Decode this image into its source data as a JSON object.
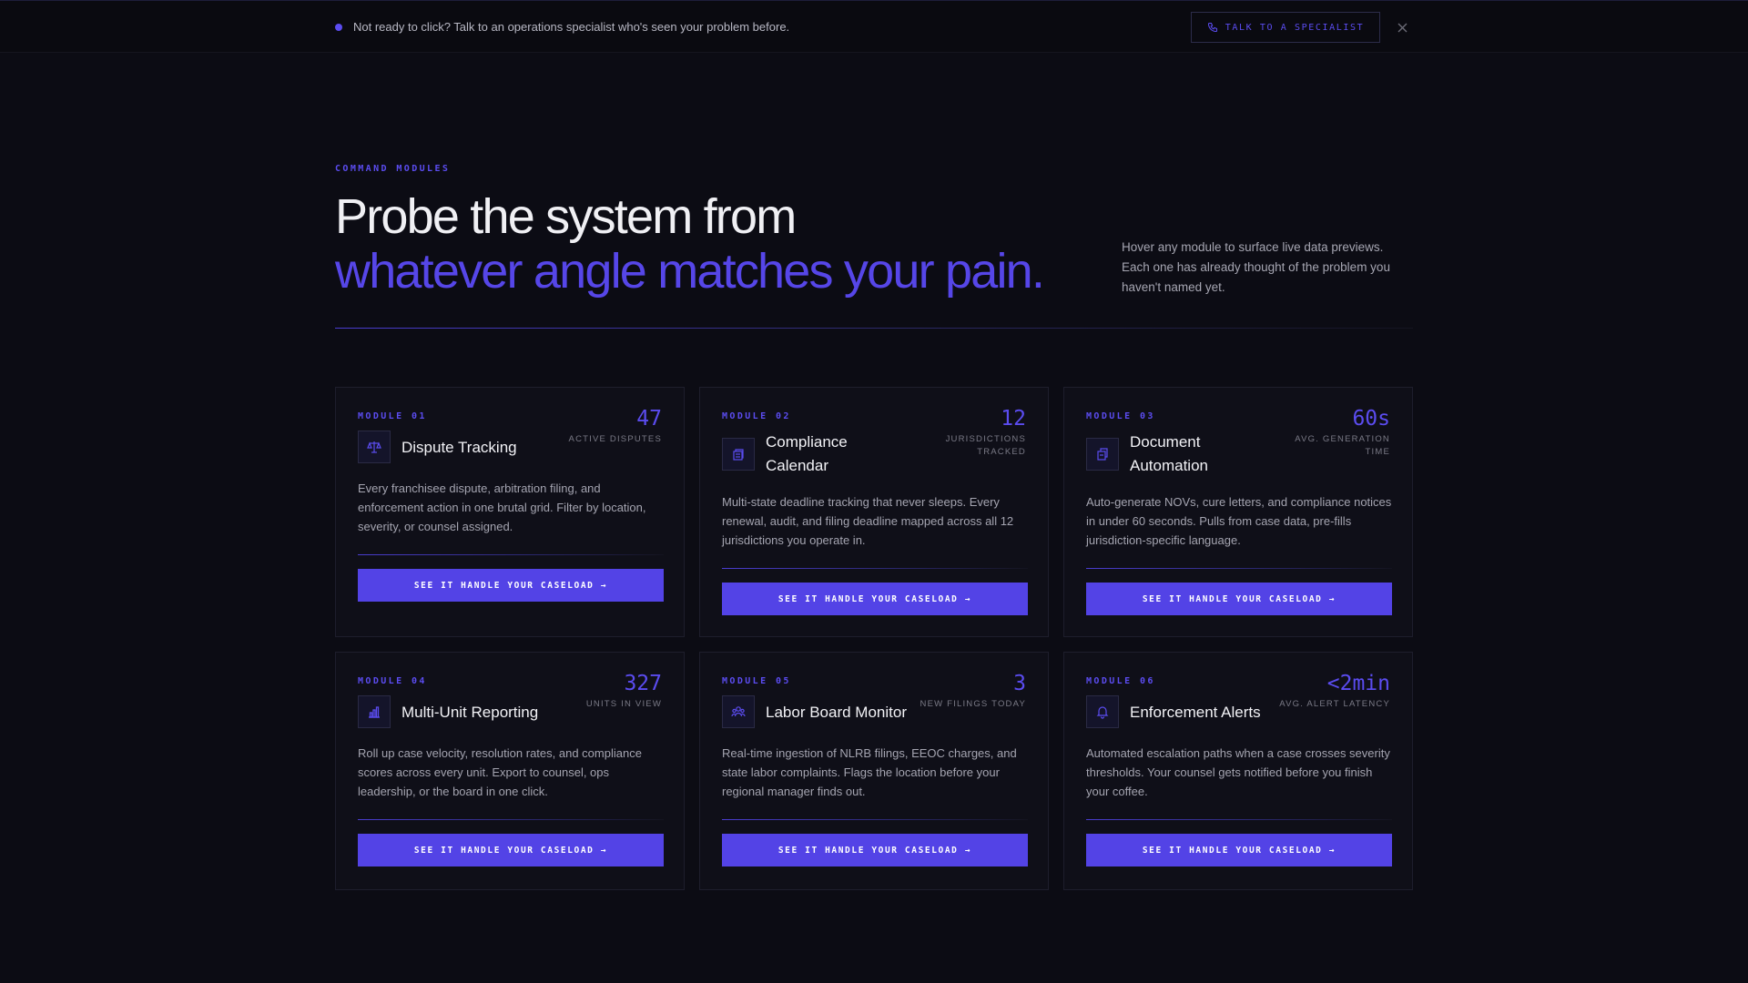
{
  "banner": {
    "text": "Not ready to click? Talk to an operations specialist who's seen your problem before.",
    "cta_label": "TALK TO A SPECIALIST",
    "close_glyph": "×"
  },
  "hero": {
    "eyebrow": "COMMAND MODULES",
    "title_line1": "Probe the system from",
    "title_line2": "whatever angle matches your pain.",
    "description": "Hover any module to surface live data previews. Each one has already thought of the problem you haven't named yet."
  },
  "colors": {
    "background": "#0c0c14",
    "accent": "#5b4cf0",
    "button": "#5343e6"
  },
  "modules": [
    {
      "label": "MODULE 01",
      "title": "Dispute Tracking",
      "stat_value": "47",
      "stat_label": "ACTIVE DISPUTES",
      "icon": "scale-icon",
      "description": "Every franchisee dispute, arbitration filing, and enforcement action in one brutal grid. Filter by location, severity, or counsel assigned.",
      "cta": "SEE IT HANDLE YOUR CASELOAD →"
    },
    {
      "label": "MODULE 02",
      "title": "Compliance Calendar",
      "stat_value": "12",
      "stat_label": "JURISDICTIONS TRACKED",
      "icon": "calendar-icon",
      "description": "Multi-state deadline tracking that never sleeps. Every renewal, audit, and filing deadline mapped across all 12 jurisdictions you operate in.",
      "cta": "SEE IT HANDLE YOUR CASELOAD →"
    },
    {
      "label": "MODULE 03",
      "title": "Document Automation",
      "stat_value": "60s",
      "stat_label": "AVG. GENERATION TIME",
      "icon": "documents-icon",
      "description": "Auto-generate NOVs, cure letters, and compliance notices in under 60 seconds. Pulls from case data, pre-fills jurisdiction-specific language.",
      "cta": "SEE IT HANDLE YOUR CASELOAD →"
    },
    {
      "label": "MODULE 04",
      "title": "Multi-Unit Reporting",
      "stat_value": "327",
      "stat_label": "UNITS IN VIEW",
      "icon": "bar-chart-icon",
      "description": "Roll up case velocity, resolution rates, and compliance scores across every unit. Export to counsel, ops leadership, or the board in one click.",
      "cta": "SEE IT HANDLE YOUR CASELOAD →"
    },
    {
      "label": "MODULE 05",
      "title": "Labor Board Monitor",
      "stat_value": "3",
      "stat_label": "NEW FILINGS TODAY",
      "icon": "people-icon",
      "description": "Real-time ingestion of NLRB filings, EEOC charges, and state labor complaints. Flags the location before your regional manager finds out.",
      "cta": "SEE IT HANDLE YOUR CASELOAD →"
    },
    {
      "label": "MODULE 06",
      "title": "Enforcement Alerts",
      "stat_value": "<2min",
      "stat_label": "AVG. ALERT LATENCY",
      "icon": "bell-icon",
      "description": "Automated escalation paths when a case crosses severity thresholds. Your counsel gets notified before you finish your coffee.",
      "cta": "SEE IT HANDLE YOUR CASELOAD →"
    }
  ]
}
